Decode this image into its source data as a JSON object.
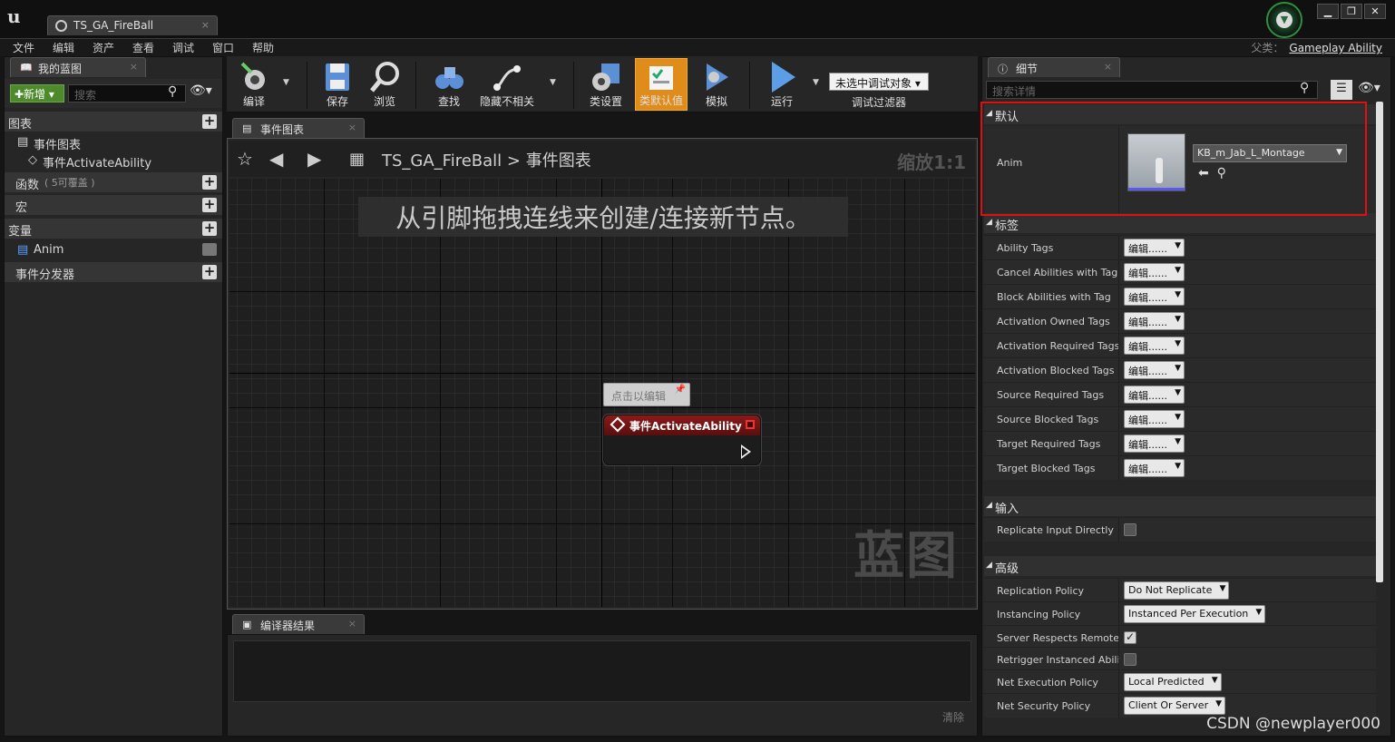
{
  "window": {
    "tab_title": "TS_GA_FireBall",
    "tab_close": "×",
    "controls": [
      "▁",
      "❐",
      "✕"
    ]
  },
  "menu": [
    "文件",
    "编辑",
    "资产",
    "查看",
    "调试",
    "窗口",
    "帮助"
  ],
  "parent_class": {
    "label": "父类：",
    "value": "Gameplay Ability"
  },
  "my_blueprint": {
    "tab": "我的蓝图",
    "new_button": "✚新增 ▾",
    "search_placeholder": "搜索",
    "graphs_label": "图表",
    "event_graph": "事件图表",
    "event_activate": "事件ActivateAbility",
    "functions_label": "函数",
    "functions_override": "( 5可覆盖 )",
    "macros_label": "宏",
    "variables_label": "变量",
    "variable_anim": "Anim",
    "dispatchers_label": "事件分发器"
  },
  "toolbar": {
    "compile": "编译",
    "save": "保存",
    "browse": "浏览",
    "find": "查找",
    "hide_unrelated": "隐藏不相关",
    "class_settings": "类设置",
    "class_defaults": "类默认值",
    "simulate": "模拟",
    "run": "运行",
    "debug_object": "未选中调试对象",
    "debug_filter": "调试过滤器"
  },
  "graph": {
    "tab": "事件图表",
    "breadcrumb_bp": "TS_GA_FireBall",
    "breadcrumb_sep": ">",
    "breadcrumb_graph": "事件图表",
    "zoom": "缩放1:1",
    "hint": "从引脚拖拽连线来创建/连接新节点。",
    "watermark": "蓝图",
    "comment": "点击以编辑",
    "node_title": "事件ActivateAbility"
  },
  "compiler": {
    "tab": "编译器结果",
    "clear": "清除"
  },
  "details": {
    "tab": "细节",
    "search_placeholder": "搜索详情",
    "sections": {
      "default": "默认",
      "tags": "标签",
      "input": "输入",
      "advanced": "高级"
    },
    "anim_label": "Anim",
    "anim_value": "KB_m_Jab_L_Montage",
    "tag_rows": [
      {
        "name": "Ability Tags",
        "value": "编辑......"
      },
      {
        "name": "Cancel Abilities with Tag",
        "value": "编辑......"
      },
      {
        "name": "Block Abilities with Tag",
        "value": "编辑......"
      },
      {
        "name": "Activation Owned Tags",
        "value": "编辑......"
      },
      {
        "name": "Activation Required Tags",
        "value": "编辑......"
      },
      {
        "name": "Activation Blocked Tags",
        "value": "编辑......"
      },
      {
        "name": "Source Required Tags",
        "value": "编辑......"
      },
      {
        "name": "Source Blocked Tags",
        "value": "编辑......"
      },
      {
        "name": "Target Required Tags",
        "value": "编辑......"
      },
      {
        "name": "Target Blocked Tags",
        "value": "编辑......"
      }
    ],
    "replicate_input": "Replicate Input Directly",
    "replication_policy": {
      "name": "Replication Policy",
      "value": "Do Not Replicate"
    },
    "instancing_policy": {
      "name": "Instancing Policy",
      "value": "Instanced Per Execution"
    },
    "server_respects": "Server Respects Remote A",
    "retrigger": "Retrigger Instanced Ability",
    "net_execution": {
      "name": "Net Execution Policy",
      "value": "Local Predicted"
    },
    "net_security": {
      "name": "Net Security Policy",
      "value": "Client Or Server"
    }
  },
  "watermark_csdn": "CSDN @newplayer000"
}
